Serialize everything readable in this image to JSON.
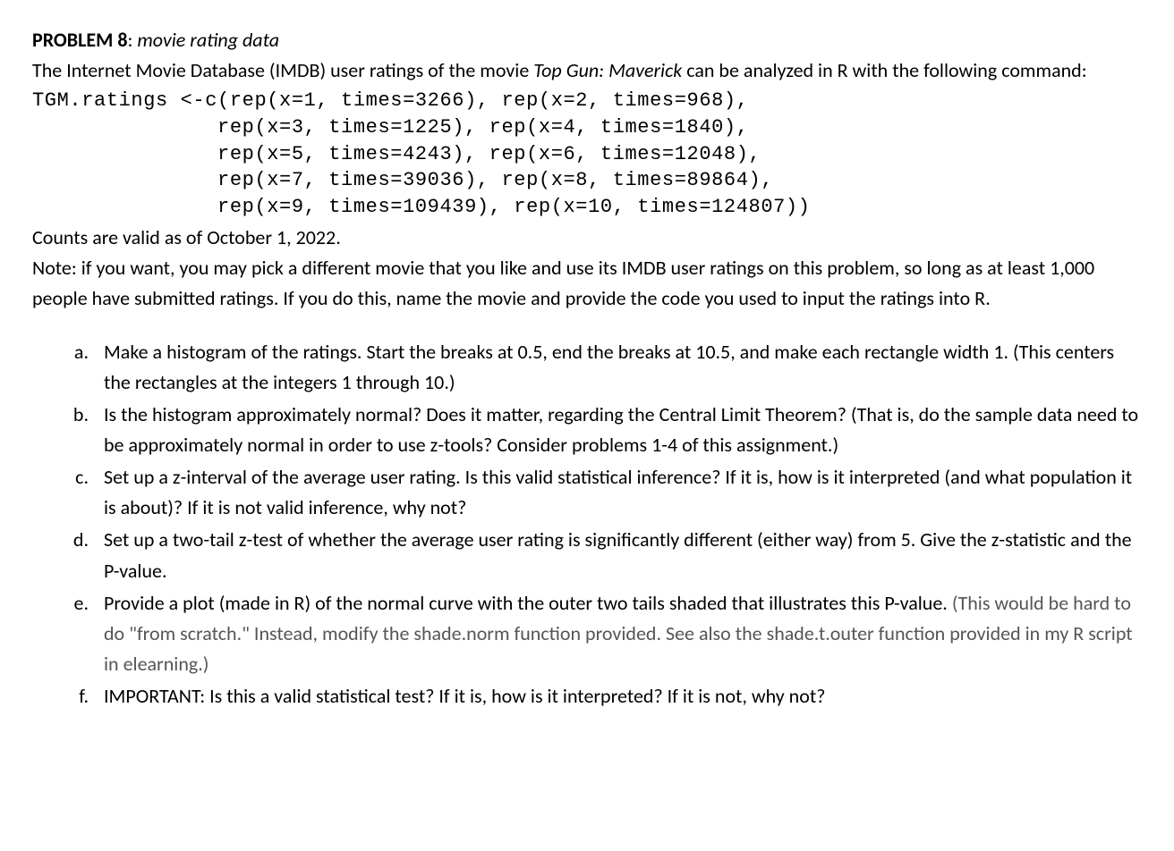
{
  "header": {
    "problem_label": "PROBLEM 8",
    "sep": ": ",
    "subtitle": "movie rating data"
  },
  "intro": {
    "before_movie": "The Internet Movie Database (IMDB) user ratings of the movie ",
    "movie": "Top Gun: Maverick",
    "after_movie": " can be analyzed in R with the following command:"
  },
  "code": "TGM.ratings <-c(rep(x=1, times=3266), rep(x=2, times=968),\n               rep(x=3, times=1225), rep(x=4, times=1840),\n               rep(x=5, times=4243), rep(x=6, times=12048),\n               rep(x=7, times=39036), rep(x=8, times=89864),\n               rep(x=9, times=109439), rep(x=10, times=124807))",
  "validity": "Counts are valid as of October 1, 2022.",
  "note": "Note: if you want, you may pick a different movie that you like and use its IMDB user ratings on this problem, so long as at least 1,000 people have submitted ratings. If you do this, name the movie and provide the code you used to input the ratings into R.",
  "items": {
    "a": "Make a histogram of the ratings. Start the breaks at 0.5, end the breaks at 10.5, and make each rectangle width 1. (This centers the rectangles at the integers 1 through 10.)",
    "b": "Is the histogram approximately normal? Does it matter, regarding the Central Limit Theorem? (That is, do the sample data need to be approximately normal in order to use z-tools? Consider problems 1-4 of this assignment.)",
    "c": "Set up a z-interval of the average user rating. Is this valid statistical inference? If it is, how is it interpreted (and what population it is about)? If it is not valid inference, why not?",
    "d": "Set up a two-tail z-test of whether the average user rating is significantly different (either way) from 5. Give the z-statistic and the P-value.",
    "e_main": "Provide a plot (made in R) of the normal curve with the outer two tails shaded that illustrates this P-value. ",
    "e_aside": "(This would be hard to do \"from scratch.\" Instead, modify the shade.norm function provided. See also the shade.t.outer function provided in my R script in elearning.)",
    "f": "IMPORTANT: Is this a valid statistical test? If it is, how is it interpreted? If it is not, why not?"
  }
}
